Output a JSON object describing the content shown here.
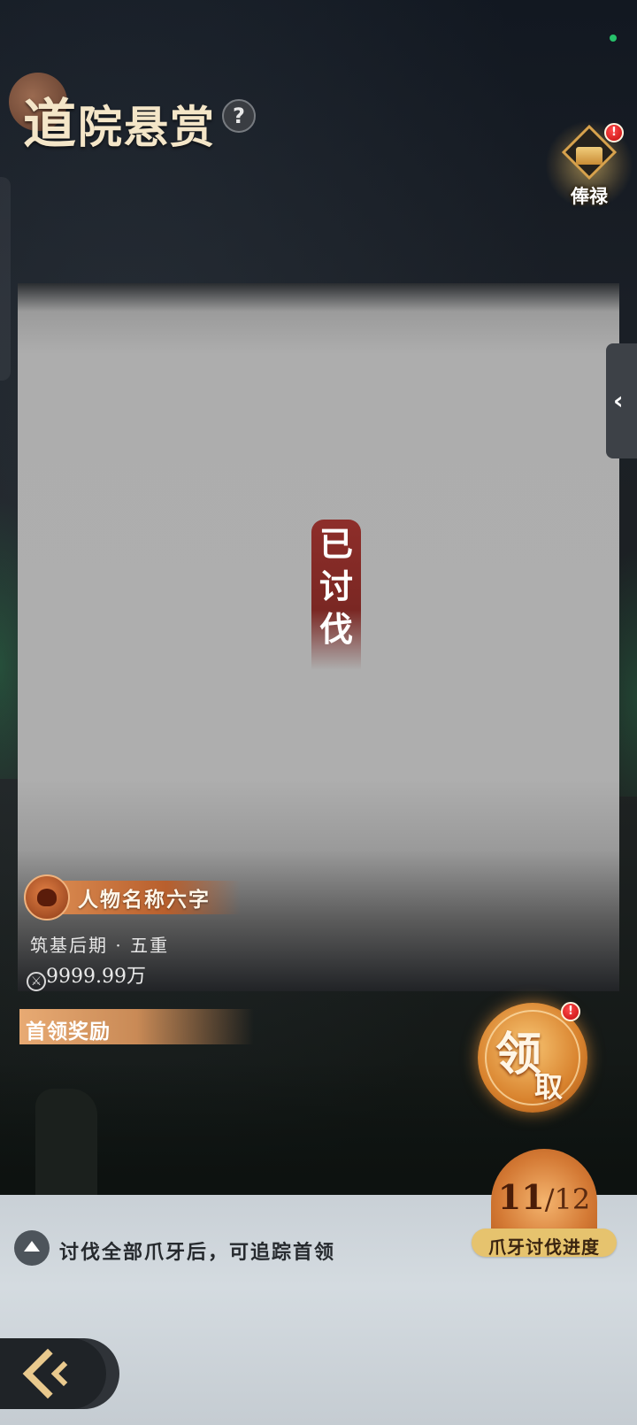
{
  "header": {
    "title_first": "道",
    "title_rest": "院悬赏",
    "help_label": "?"
  },
  "salary": {
    "label": "俸禄",
    "badge": "!"
  },
  "boss": {
    "status_tag": "已讨伐",
    "name": "人物名称六字",
    "realm": "筑基后期 · 五重",
    "power": "9999.99万",
    "power_icon": "sword-icon"
  },
  "reward": {
    "header": "首领奖励",
    "claim_big": "领",
    "claim_small": "取",
    "claim_badge": "!"
  },
  "progress": {
    "current": "11",
    "separator": "/",
    "total": "12",
    "label": "爪牙讨伐进度"
  },
  "hint": {
    "text": "讨伐全部爪牙后，可追踪首领"
  },
  "colors": {
    "accent_gold": "#e9c98d",
    "defeated_red": "#8e2e2a",
    "progress_orange": "#d47a35"
  }
}
